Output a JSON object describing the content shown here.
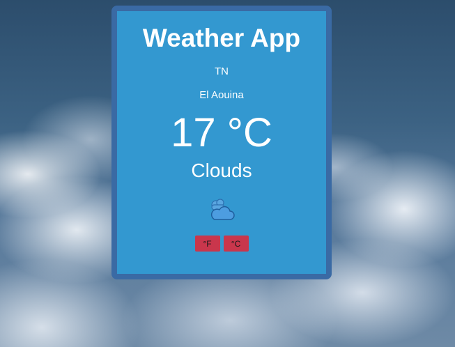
{
  "app": {
    "title": "Weather App"
  },
  "location": {
    "country": "TN",
    "city": "El Aouina"
  },
  "weather": {
    "temperature": "17 °C",
    "description": "Clouds",
    "icon": "cloud-icon"
  },
  "units": {
    "fahrenheit_label": "°F",
    "celsius_label": "°C"
  },
  "colors": {
    "card_border": "#3a6aa4",
    "card_background": "#3398d0",
    "unit_button": "#c9364c"
  }
}
